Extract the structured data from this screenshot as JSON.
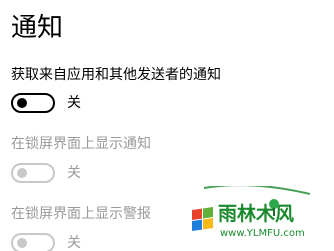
{
  "page": {
    "title": "通知"
  },
  "settings": [
    {
      "label": "获取来自应用和其他发送者的通知",
      "toggle_state": "关",
      "enabled": true
    },
    {
      "label": "在锁屏界面上显示通知",
      "toggle_state": "关",
      "enabled": false
    },
    {
      "label": "在锁屏界面上显示警报",
      "toggle_state": "关",
      "enabled": false
    }
  ],
  "watermark": {
    "text": "雨林木风",
    "url": "www.YLMFU.com"
  },
  "colors": {
    "text": "#000000",
    "disabled_text": "#9a9a9a",
    "toggle_disabled": "#c8c8c8",
    "watermark_green": "#1b8a2e"
  }
}
